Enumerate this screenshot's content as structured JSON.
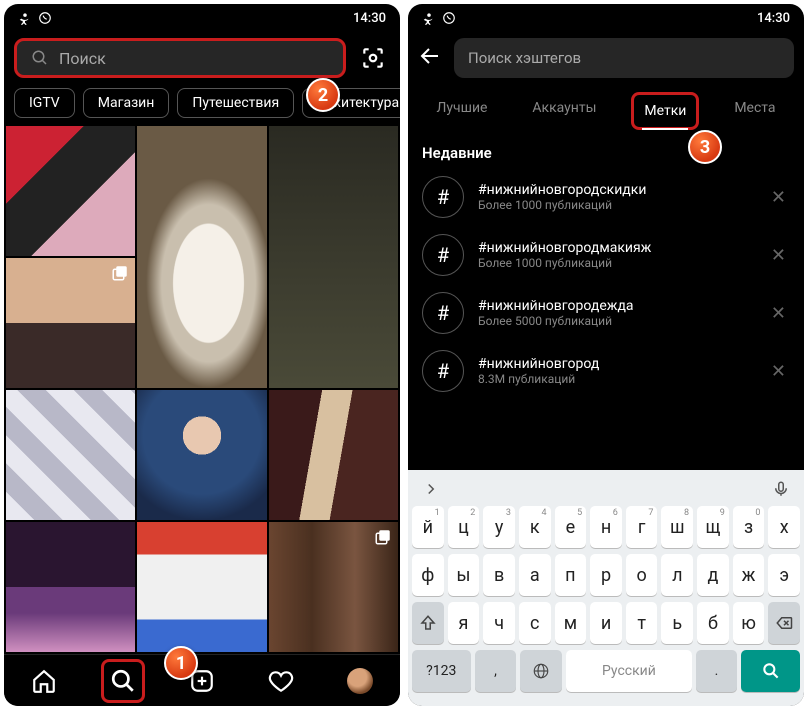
{
  "status": {
    "time": "14:30"
  },
  "left": {
    "search_placeholder": "Поиск",
    "chips": [
      "IGTV",
      "Магазин",
      "Путешествия",
      "Архитектура"
    ]
  },
  "right": {
    "search_placeholder": "Поиск хэштегов",
    "tabs": [
      "Лучшие",
      "Аккаунты",
      "Метки",
      "Места"
    ],
    "recent_title": "Недавние",
    "hashtags": [
      {
        "name": "#нижнийновгородскидки",
        "count": "Более 1000 публикаций"
      },
      {
        "name": "#нижнийновгородмакияж",
        "count": "Более 1000 публикаций"
      },
      {
        "name": "#нижнийновгородежда",
        "count": "Более 5000 публикаций"
      },
      {
        "name": "#нижнийновгород",
        "count": "8.3M публикаций"
      }
    ]
  },
  "keyboard": {
    "row1": [
      "й",
      "ц",
      "у",
      "к",
      "е",
      "н",
      "г",
      "ш",
      "щ",
      "з",
      "х"
    ],
    "hints": [
      "1",
      "2",
      "3",
      "4",
      "5",
      "6",
      "7",
      "8",
      "9",
      "0",
      ""
    ],
    "row2": [
      "ф",
      "ы",
      "в",
      "а",
      "п",
      "р",
      "о",
      "л",
      "д",
      "ж",
      "э"
    ],
    "row3": [
      "я",
      "ч",
      "с",
      "м",
      "и",
      "т",
      "ь",
      "б",
      "ю"
    ],
    "numkey": "?123",
    "comma": ",",
    "space": "Русский",
    "dot": "."
  },
  "callouts": {
    "b1": "1",
    "b2": "2",
    "b3": "3"
  }
}
